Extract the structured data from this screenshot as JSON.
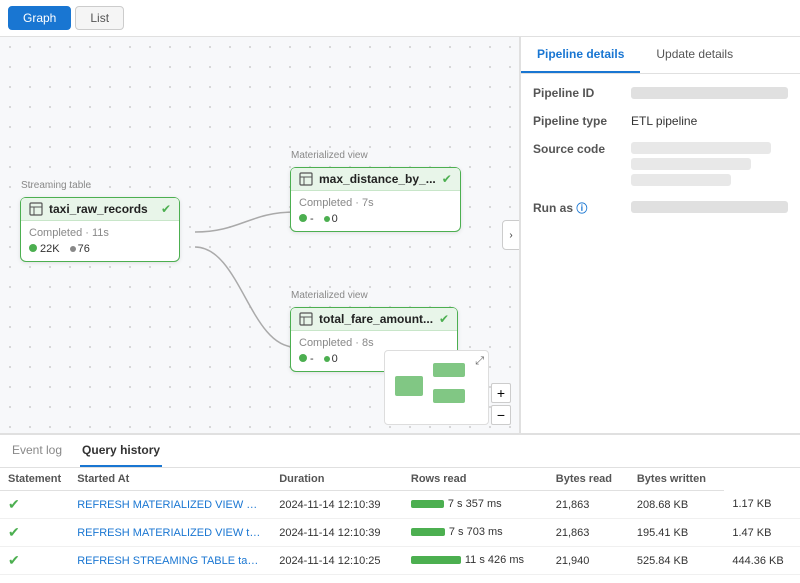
{
  "tabs": {
    "graph_label": "Graph",
    "list_label": "List",
    "active": "graph"
  },
  "panel": {
    "tab1": "Pipeline details",
    "tab2": "Update details",
    "active": "tab1",
    "rows": [
      {
        "label": "Pipeline ID",
        "value": "",
        "blur": true
      },
      {
        "label": "Pipeline type",
        "value": "ETL pipeline",
        "blur": false
      },
      {
        "label": "Source code",
        "value": "",
        "blur": true,
        "multiline": true
      },
      {
        "label": "Run as",
        "value": "",
        "blur": true
      }
    ]
  },
  "nodes": {
    "streaming": {
      "label": "Streaming table",
      "title": "taxi_raw_records",
      "status": "Completed · 11s",
      "stat1": "22K",
      "stat2": "76"
    },
    "mat1": {
      "label": "Materialized view",
      "title": "max_distance_by_...",
      "status": "Completed · 7s",
      "stat1": "-",
      "stat2": "0"
    },
    "mat2": {
      "label": "Materialized view",
      "title": "total_fare_amount...",
      "status": "Completed · 8s",
      "stat1": "-",
      "stat2": "0"
    }
  },
  "bottom_tabs": {
    "event_log": "Event log",
    "query_history": "Query history",
    "active": "query_history"
  },
  "table": {
    "headers": [
      "Statement",
      "Started At",
      "Duration",
      "Rows read",
      "Bytes read",
      "Bytes written"
    ],
    "rows": [
      {
        "status": "ok",
        "statement": "REFRESH MATERIALIZED VIEW max_di...",
        "started_at": "2024-11-14 12:10:39",
        "duration_text": "7 s 357 ms",
        "duration_pct": 65,
        "rows_read": "21,863",
        "bytes_read": "208.68 KB",
        "bytes_written": "1.17 KB"
      },
      {
        "status": "ok",
        "statement": "REFRESH MATERIALIZED VIEW total_fa...",
        "started_at": "2024-11-14 12:10:39",
        "duration_text": "7 s 703 ms",
        "duration_pct": 68,
        "rows_read": "21,863",
        "bytes_read": "195.41 KB",
        "bytes_written": "1.47 KB"
      },
      {
        "status": "ok",
        "statement": "REFRESH STREAMING TABLE taxi_raw...",
        "started_at": "2024-11-14 12:10:25",
        "duration_text": "11 s 426 ms",
        "duration_pct": 100,
        "rows_read": "21,940",
        "bytes_read": "525.84 KB",
        "bytes_written": "444.36 KB"
      }
    ]
  },
  "minimap": {
    "expand_icon": "⤢",
    "zoom_in": "+",
    "zoom_out": "−"
  },
  "collapse_icon": "›"
}
